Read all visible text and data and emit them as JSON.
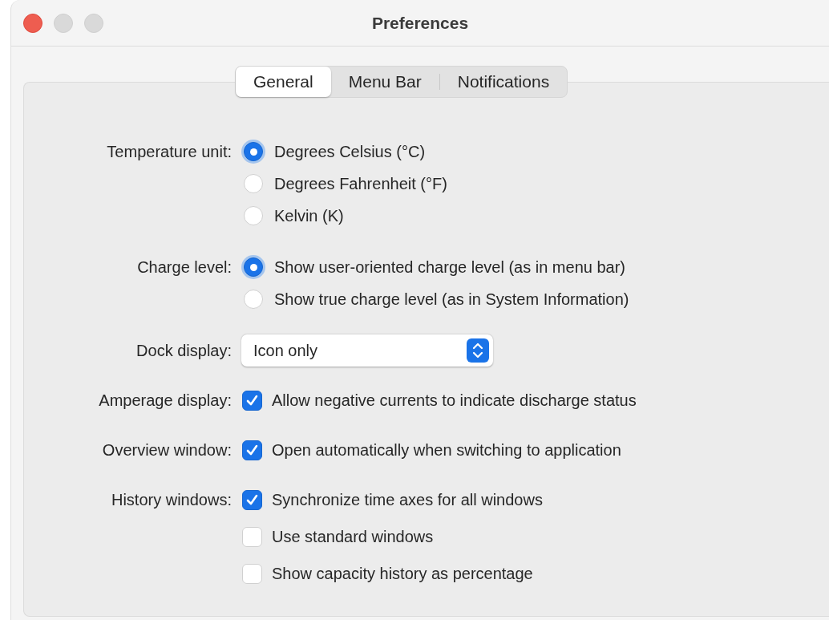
{
  "window": {
    "title": "Preferences"
  },
  "tabs": [
    {
      "label": "General",
      "selected": true
    },
    {
      "label": "Menu Bar",
      "selected": false
    },
    {
      "label": "Notifications",
      "selected": false
    }
  ],
  "settings": [
    {
      "label": "Temperature unit:",
      "kind": "radio",
      "options": [
        {
          "label": "Degrees Celsius (°C)",
          "selected": true
        },
        {
          "label": "Degrees Fahrenheit (°F)",
          "selected": false
        },
        {
          "label": "Kelvin (K)",
          "selected": false
        }
      ]
    },
    {
      "label": "Charge level:",
      "kind": "radio",
      "options": [
        {
          "label": "Show user-oriented charge level (as in menu bar)",
          "selected": true
        },
        {
          "label": "Show true charge level (as in System Information)",
          "selected": false
        }
      ]
    },
    {
      "label": "Dock display:",
      "kind": "popup",
      "value": "Icon only"
    },
    {
      "label": "Amperage display:",
      "kind": "checkbox",
      "options": [
        {
          "label": "Allow negative currents to indicate discharge status",
          "checked": true
        }
      ]
    },
    {
      "label": "Overview window:",
      "kind": "checkbox",
      "options": [
        {
          "label": "Open automatically when switching to application",
          "checked": true
        }
      ]
    },
    {
      "label": "History windows:",
      "kind": "checkbox",
      "options": [
        {
          "label": "Synchronize time axes for all windows",
          "checked": true
        },
        {
          "label": "Use standard windows",
          "checked": false
        },
        {
          "label": "Show capacity history as percentage",
          "checked": false
        }
      ]
    }
  ]
}
